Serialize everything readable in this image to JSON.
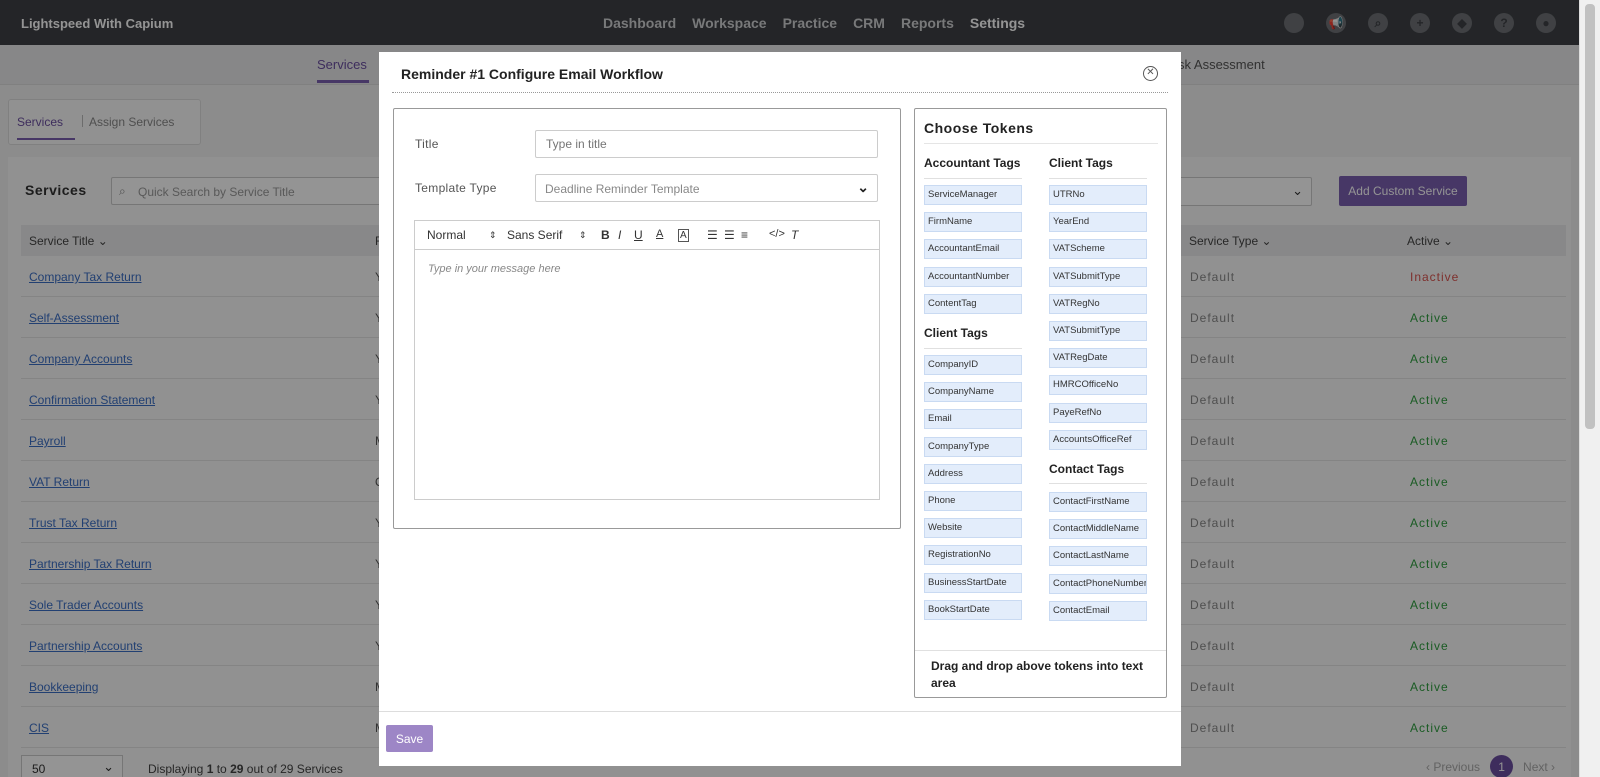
{
  "app": {
    "brand": "Lightspeed With Capium"
  },
  "nav": {
    "items": [
      "Dashboard",
      "Workspace",
      "Practice",
      "CRM",
      "Reports",
      "Settings"
    ],
    "active": "Settings"
  },
  "subnav": {
    "services": "Services",
    "risk": "sk Assessment"
  },
  "page": {
    "tab_services": "Services",
    "tab_assign": "Assign Services",
    "section_title": "Services",
    "search_placeholder": "Quick Search by Service Title",
    "add_button": "Add Custom Service",
    "col_title": "Service Title ⌄",
    "col_second": "F",
    "col_type": "Service Type ⌄",
    "col_active": "Active ⌄",
    "rows": [
      {
        "title": "Company Tax Return",
        "c2": "Y",
        "type": "Default",
        "status": "Inactive"
      },
      {
        "title": "Self-Assessment",
        "c2": "Y",
        "type": "Default",
        "status": "Active"
      },
      {
        "title": "Company Accounts",
        "c2": "Y",
        "type": "Default",
        "status": "Active"
      },
      {
        "title": "Confirmation Statement",
        "c2": "Y",
        "type": "Default",
        "status": "Active"
      },
      {
        "title": "Payroll",
        "c2": "M",
        "type": "Default",
        "status": "Active"
      },
      {
        "title": "VAT Return",
        "c2": "Q",
        "type": "Default",
        "status": "Active"
      },
      {
        "title": "Trust Tax Return",
        "c2": "Y",
        "type": "Default",
        "status": "Active"
      },
      {
        "title": "Partnership Tax Return",
        "c2": "Y",
        "type": "Default",
        "status": "Active"
      },
      {
        "title": "Sole Trader Accounts",
        "c2": "Y",
        "type": "Default",
        "status": "Active"
      },
      {
        "title": "Partnership Accounts",
        "c2": "Y",
        "type": "Default",
        "status": "Active"
      },
      {
        "title": "Bookkeeping",
        "c2": "M",
        "type": "Default",
        "status": "Active"
      },
      {
        "title": "CIS",
        "c2": "M",
        "type": "Default",
        "status": "Active"
      }
    ],
    "page_size": "50",
    "displaying_prefix": "Displaying ",
    "displaying_from": "1",
    "displaying_mid": " to ",
    "displaying_to": "29",
    "displaying_suffix": " out of 29 Services",
    "pager_prev": "‹ Previous",
    "pager_current": "1",
    "pager_next": "Next ›"
  },
  "modal": {
    "title": "Reminder #1 Configure Email Workflow",
    "title_label": "Title",
    "title_placeholder": "Type in title",
    "template_label": "Template Type",
    "template_value": "Deadline Reminder Template",
    "editor_format": "Normal",
    "editor_font": "Sans Serif",
    "editor_placeholder": "Type in your message here",
    "save_label": "Save"
  },
  "tokens": {
    "title": "Choose Tokens",
    "accountant_heading": "Accountant Tags",
    "accountant": [
      "ServiceManager",
      "FirmName",
      "AccountantEmail",
      "AccountantNumber",
      "ContentTag"
    ],
    "client_heading_left": "Client Tags",
    "client_left": [
      "CompanyID",
      "CompanyName",
      "Email",
      "CompanyType",
      "Address",
      "Phone",
      "Website",
      "RegistrationNo",
      "BusinessStartDate",
      "BookStartDate"
    ],
    "client_heading_right": "Client Tags",
    "client_right": [
      "UTRNo",
      "YearEnd",
      "VATScheme",
      "VATSubmitType",
      "VATRegNo",
      "VATSubmitType",
      "VATRegDate",
      "HMRCOfficeNo",
      "PayeRefNo",
      "AccountsOfficeRef"
    ],
    "contact_heading": "Contact Tags",
    "contact": [
      "ContactFirstName",
      "ContactMiddleName",
      "ContactLastName",
      "ContactPhoneNumber",
      "ContactEmail"
    ],
    "hint": "Drag and drop above tokens into text area"
  },
  "colors": {
    "accent": "#7a5fb0",
    "active_status": "#2e9e3e",
    "inactive_status": "#d9534f",
    "chip_bg": "#e3edfb",
    "topbar": "#3e4145"
  }
}
